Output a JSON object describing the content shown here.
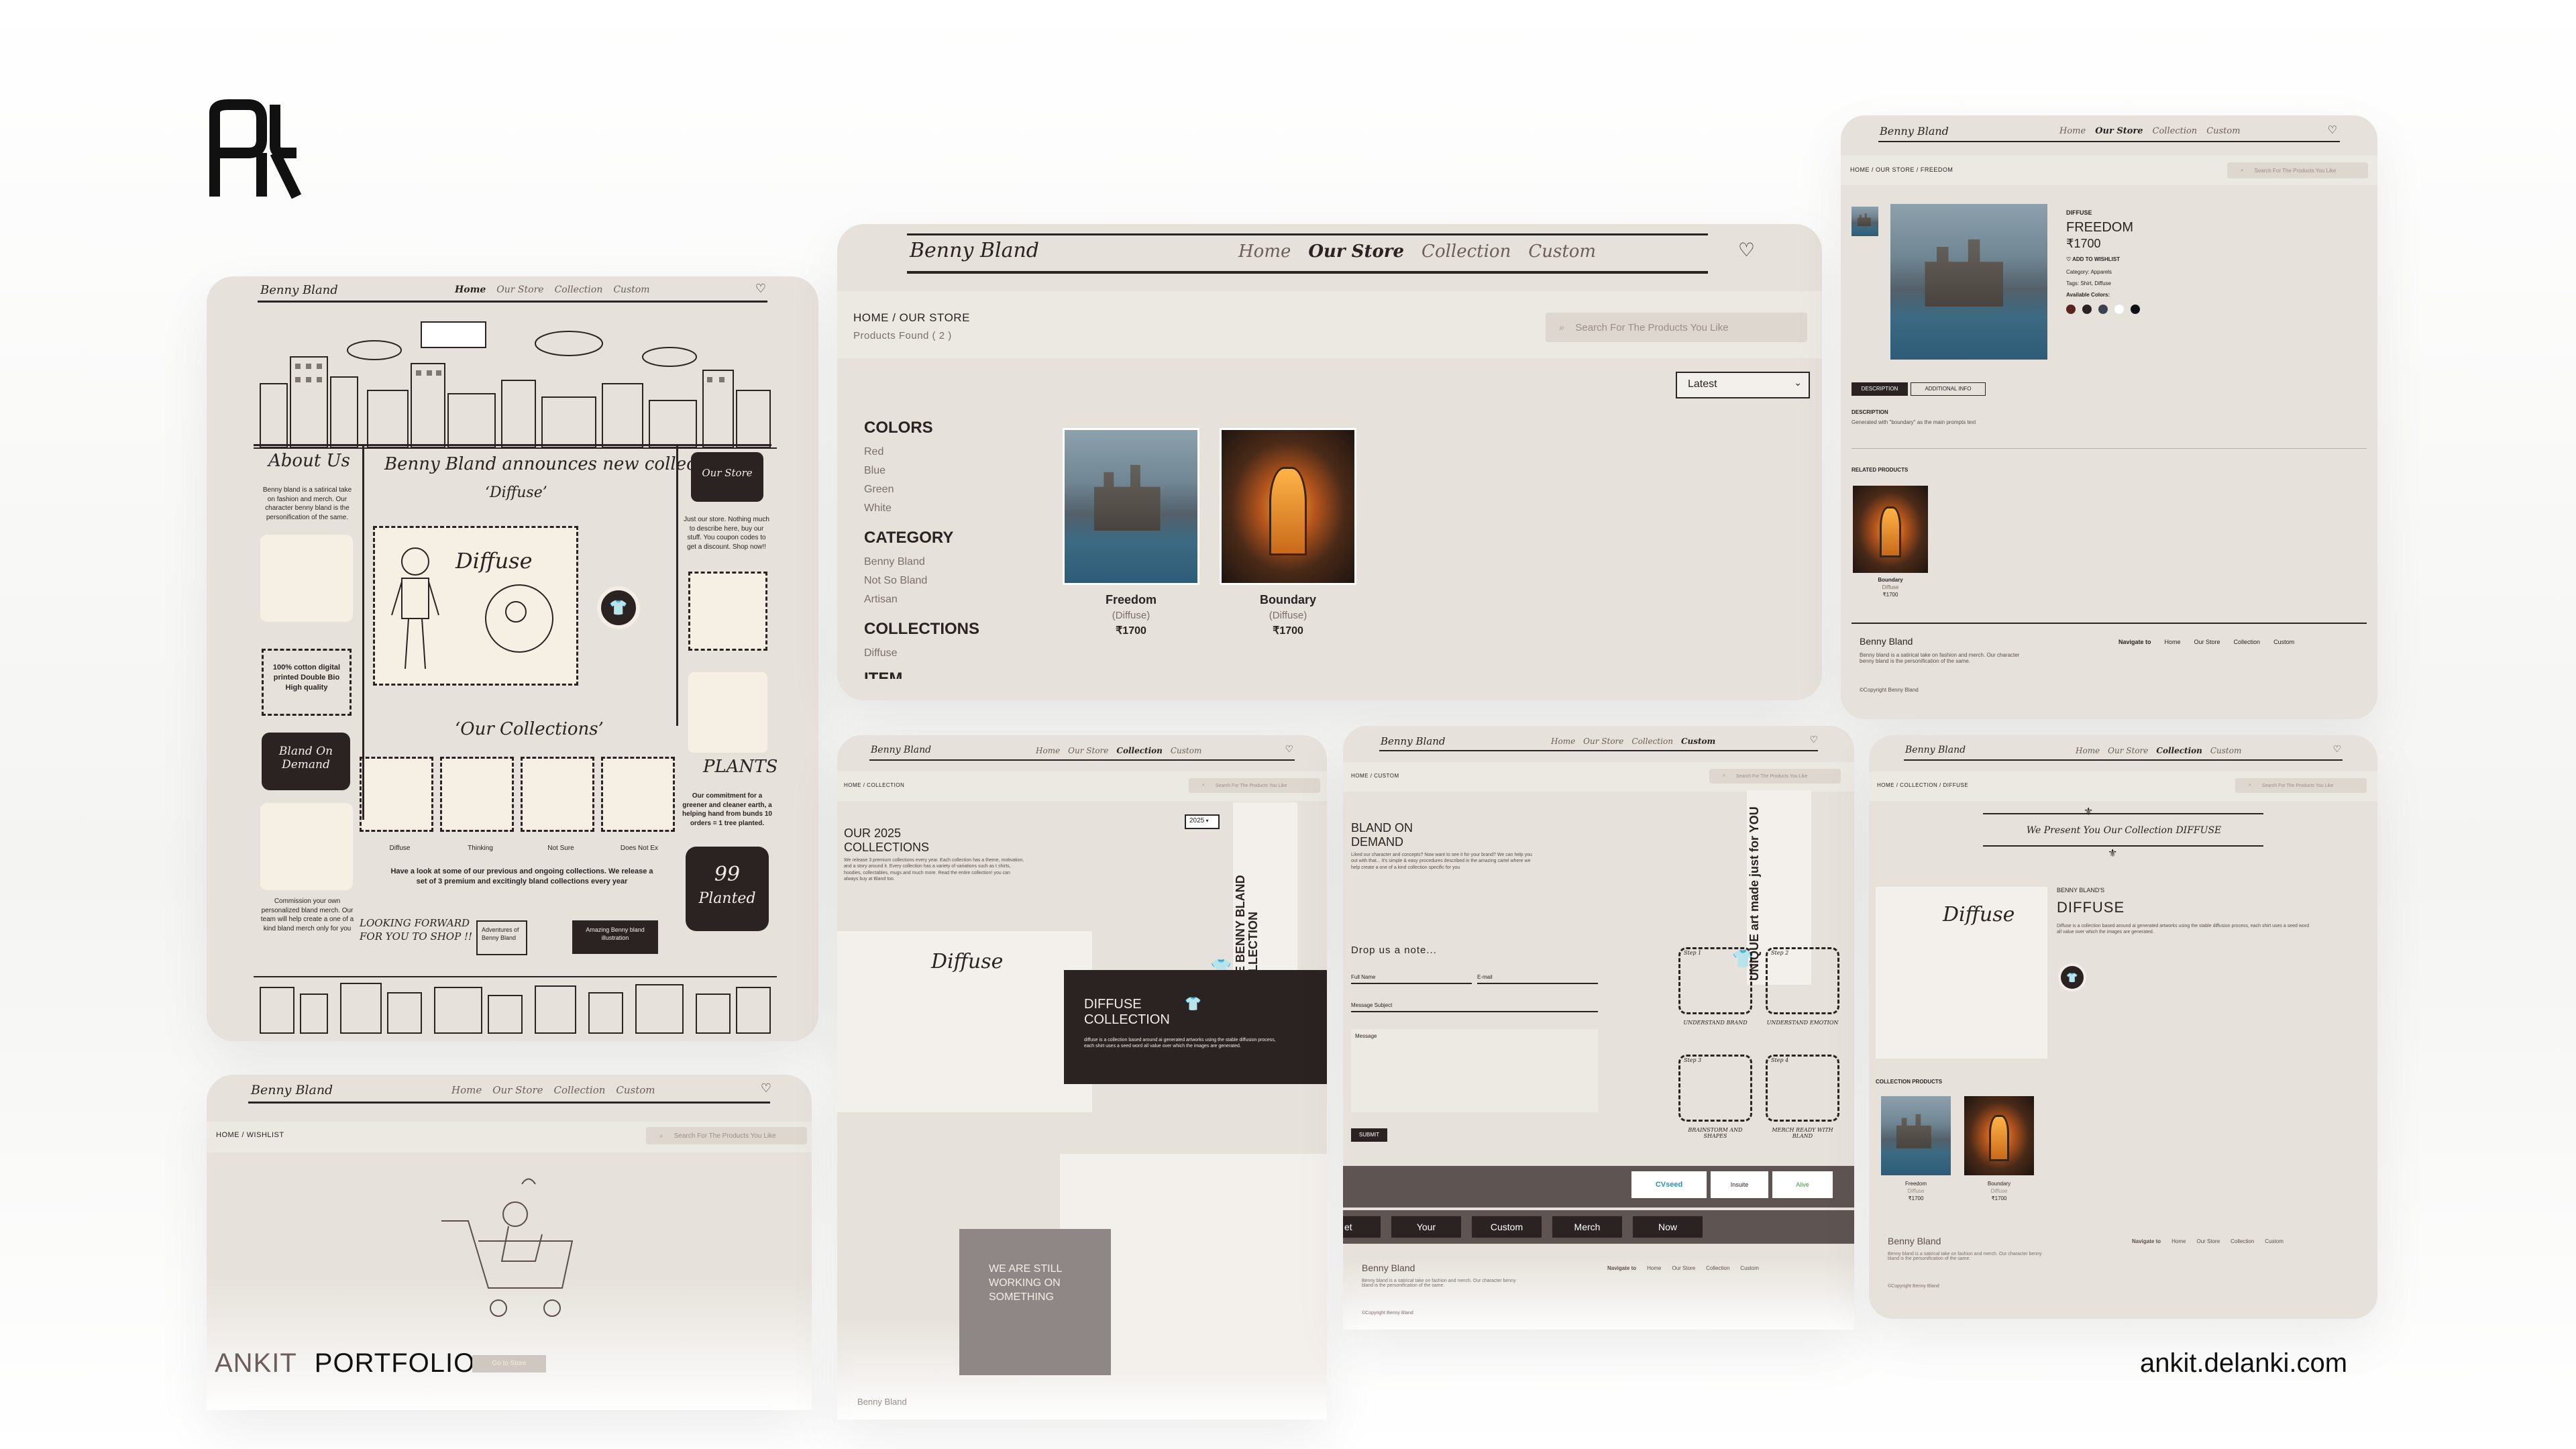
{
  "logo": {
    "alt": "AK monogram logo"
  },
  "bottom": {
    "first_name": "ANKIT",
    "last_name": "PORTFOLIO",
    "store_button": "Go to Store",
    "website": "ankit.delanki.com"
  },
  "nav": {
    "brand": "Benny Bland",
    "links": [
      "Home",
      "Our Store",
      "Collection",
      "Custom"
    ]
  },
  "search_placeholder": "Search For The Products You Like",
  "home_card": {
    "about_title": "About Us",
    "about_text": "Benny bland is a satirical take on fashion and merch. Our character benny bland is the personification of the same.",
    "cotton_text": "100% cotton digital printed Double Bio High quality",
    "bland_on_demand": "Bland On Demand",
    "commission_text": "Commission your own personalized bland merch. Our team will help create a one of a kind bland merch only for you",
    "announce_title": "Benny Bland announces new collection",
    "announce_sub": "‘Diffuse’",
    "diffuse_word": "Diffuse",
    "our_store": "Our Store",
    "store_text": "Just our store. Nothing much to describe here, buy our stuff. You coupon codes to get a discount. Shop now!!",
    "collections_title": "‘Our Collections’",
    "collection_items": [
      "Diffuse",
      "Thinking",
      "Not Sure",
      "Does Not Ex"
    ],
    "collections_text": "Have a look at some of our previous and ongoing collections. We release a set of 3 premium and excitingly bland collections every year",
    "plants_title": "PLANTS",
    "plants_text": "Our commitment for a greener and cleaner earth, a helping hand from bunds 10 orders = 1 tree planted.",
    "planted_count": "99",
    "planted_label": "Planted",
    "looking_forward": "LOOKING FORWARD FOR YOU TO SHOP !!",
    "adventures": "Adventures of Benny Bland",
    "amazing": "Amazing Benny bland illustration"
  },
  "store_card": {
    "crumb": "HOME / OUR STORE",
    "found": "Products Found ( 2 )",
    "sort": "Latest",
    "colors_title": "COLORS",
    "colors": [
      "Red",
      "Blue",
      "Green",
      "White"
    ],
    "category_title": "CATEGORY",
    "categories": [
      "Benny Bland",
      "Not So Bland",
      "Artisan"
    ],
    "collections_title": "COLLECTIONS",
    "collections": [
      "Diffuse"
    ],
    "item_title": "ITEM",
    "products": [
      {
        "name": "Freedom",
        "collection": "(Diffuse)",
        "price": "₹1700"
      },
      {
        "name": "Boundary",
        "collection": "(Diffuse)",
        "price": "₹1700"
      }
    ]
  },
  "product_card": {
    "crumb": "HOME / OUR STORE / FREEDOM",
    "collection": "DIFFUSE",
    "name": "FREEDOM",
    "price": "₹1700",
    "wishlist": "ADD TO WISHLIST",
    "category": "Category: Apparels",
    "tags": "Tags: Shirt, Diffuse",
    "available": "Available Colors:",
    "swatches": [
      "#5a2320",
      "#2b2222",
      "#3e4250",
      "#ffffff",
      "#111111"
    ],
    "tab_desc": "DESCRIPTION",
    "tab_info": "ADDITIONAL INFO",
    "desc_title": "DESCRIPTION",
    "desc_text": "Generated with \"boundary\" as the main prompts text",
    "related_title": "RELATED PRODUCTS",
    "related_name": "Boundary",
    "related_coll": "Diffuse",
    "related_price": "₹1700",
    "footer_brand": "Benny Bland",
    "footer_text": "Benny bland is a satirical take on fashion and merch. Our character benny bland is the personification of the same.",
    "copyright": "©Copyright Benny Bland",
    "navigate": "Navigate to"
  },
  "wishlist_card": {
    "crumb": "HOME / WISHLIST"
  },
  "collection_card": {
    "crumb": "HOME / COLLECTION",
    "title": "OUR 2025 COLLECTIONS",
    "text": "We release 3 premium collections every year. Each collection has a theme, motivation, and a story around it. Every collection has a variety of variations such as t shirts, hoodies, collectables, mugs and much more. Read the entire collection! you can always buy at Bland too.",
    "year": "2025",
    "vertical": "THE BENNY BLAND COLLECTION",
    "diffuse_title": "DIFFUSE COLLECTION",
    "diffuse_text": "diffuse is a collection based around ai generated artworks using the stable diffusion process, each shirt uses a seed word all value over which the images are generated.",
    "working": "WE ARE STILL WORKING ON SOMETHING",
    "footer_brand": "Benny Bland"
  },
  "custom_card": {
    "crumb": "HOME / CUSTOM",
    "title": "BLAND ON DEMAND",
    "text": "Liked our character and concepts? Now want to see it for your brand? We can help you out with that... It's simple & easy procedures described in the amazing cartel where we help create a one of a kind collection specific for you",
    "vertical": "UNIQUE art made just for YOU",
    "drop_note": "Drop us a note...",
    "full_name": "Full Name",
    "email": "E-mail",
    "subject": "Message Subject",
    "message": "Message",
    "submit": "SUBMIT",
    "steps": [
      {
        "label": "Step 1",
        "text": "UNDERSTAND BRAND"
      },
      {
        "label": "Step 2",
        "text": "UNDERSTAND EMOTION"
      },
      {
        "label": "Step 3",
        "text": "BRAINSTORM AND SHAPES"
      },
      {
        "label": "Step 4",
        "text": "MERCH READY WITH BLAND"
      }
    ],
    "partners": [
      "CVseed",
      "Insuite",
      "Alive"
    ],
    "marquee": [
      "et",
      "Your",
      "Custom",
      "Merch",
      "Now"
    ],
    "footer_brand": "Benny Bland",
    "footer_text": "Benny bland is a satirical take on fashion and merch. Our character benny bland is the personification of the same.",
    "copyright": "©Copyright Benny Bland",
    "navigate": "Navigate to"
  },
  "diffuse_card": {
    "crumb": "HOME / COLLECTION / DIFFUSE",
    "banner": "We Present You Our Collection DIFFUSE",
    "kicker": "BENNY BLAND'S",
    "title": "DIFFUSE",
    "text": "Diffuse is a collection based around ai generated artworks using the stable diffusion process, each shirt uses a seed word all value over which the images are generated.",
    "products_title": "COLLECTION PRODUCTS",
    "products": [
      {
        "name": "Freedom",
        "collection": "Diffuse",
        "price": "₹1700"
      },
      {
        "name": "Boundary",
        "collection": "Diffuse",
        "price": "₹1700"
      }
    ],
    "footer_brand": "Benny Bland",
    "footer_text": "Benny bland is a satirical take on fashion and merch. Our character benny bland is the personification of the same.",
    "copyright": "©Copyright Benny Bland",
    "navigate": "Navigate to"
  }
}
